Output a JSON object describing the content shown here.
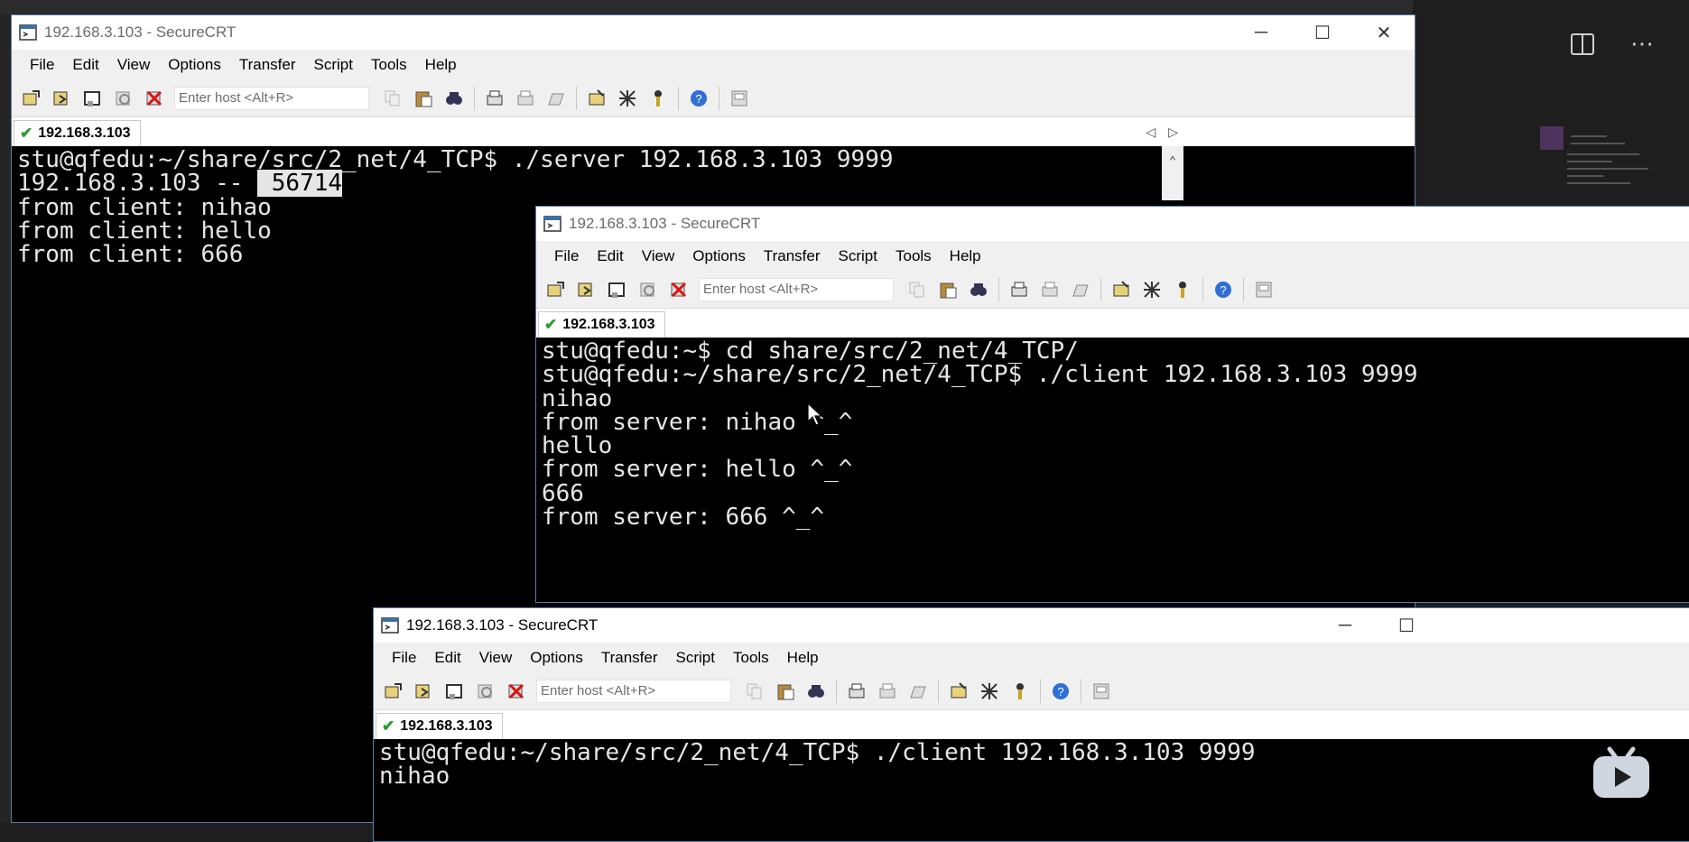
{
  "background": {
    "accent": "#1e1e1e"
  },
  "windows": [
    {
      "title": "192.168.3.103 - SecureCRT",
      "tab_label": "192.168.3.103",
      "menu": [
        "File",
        "Edit",
        "View",
        "Options",
        "Transfer",
        "Script",
        "Tools",
        "Help"
      ],
      "host_placeholder": "Enter host <Alt+R>",
      "lines": [
        "stu@qfedu:~/share/src/2_net/4_TCP$ ./server 192.168.3.103 9999",
        "192.168.3.103 -- ",
        "from client: nihao",
        "from client: hello",
        "from client: 666"
      ],
      "highlighted": " 56714"
    },
    {
      "title": "192.168.3.103 - SecureCRT",
      "tab_label": "192.168.3.103",
      "menu": [
        "File",
        "Edit",
        "View",
        "Options",
        "Transfer",
        "Script",
        "Tools",
        "Help"
      ],
      "host_placeholder": "Enter host <Alt+R>",
      "lines": [
        "stu@qfedu:~$ cd share/src/2_net/4_TCP/",
        "stu@qfedu:~/share/src/2_net/4_TCP$ ./client 192.168.3.103 9999",
        "nihao",
        "from server: nihao ^_^",
        "hello",
        "from server: hello ^_^",
        "666",
        "from server: 666 ^_^"
      ]
    },
    {
      "title": "192.168.3.103 - SecureCRT",
      "tab_label": "192.168.3.103",
      "menu": [
        "File",
        "Edit",
        "View",
        "Options",
        "Transfer",
        "Script",
        "Tools",
        "Help"
      ],
      "host_placeholder": "Enter host <Alt+R>",
      "lines": [
        "stu@qfedu:~/share/src/2_net/4_TCP$ ./client 192.168.3.103 9999",
        "nihao"
      ]
    }
  ]
}
